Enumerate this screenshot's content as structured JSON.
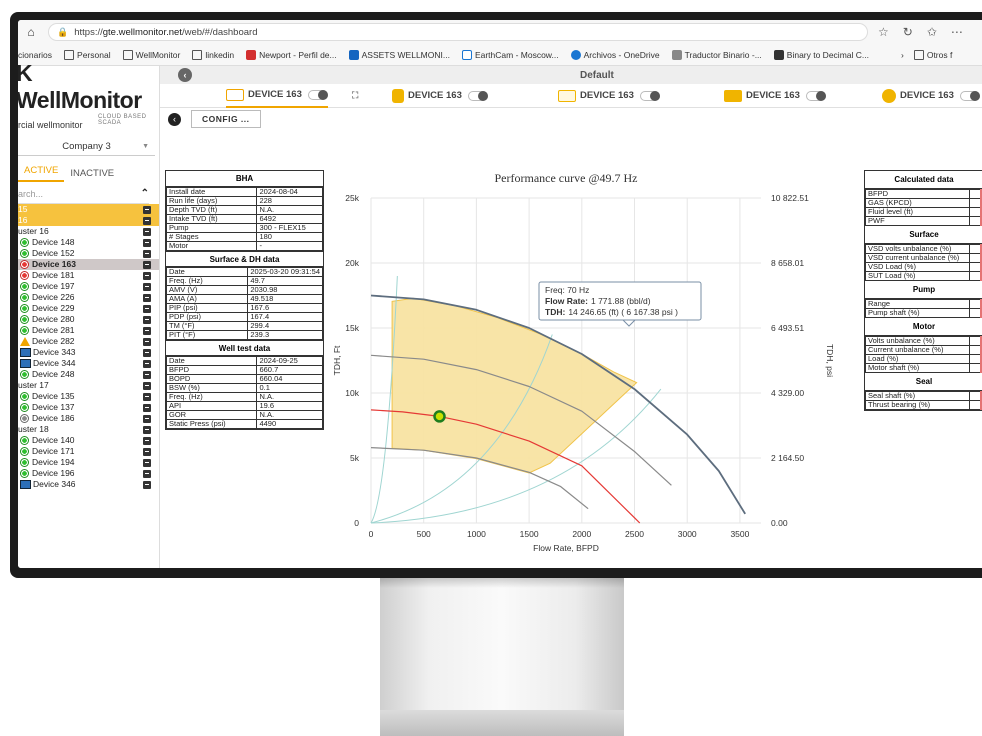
{
  "browser": {
    "url_prefix": "https://",
    "url_host": "gte.wellmonitor.net",
    "url_path": "/web/#/dashboard",
    "bookmarks": [
      "cionarios",
      "Personal",
      "WellMonitor",
      "linkedin",
      "Newport - Perfil de...",
      "ASSETS WELLMONI...",
      "EarthCam - Moscow...",
      "Archivos - OneDrive",
      "Traductor Binario -...",
      "Binary to Decimal C...",
      "Otros f"
    ]
  },
  "sidebar": {
    "logo_main": "WellMonitor",
    "logo_sub": "CLOUD BASED SCADA",
    "client": "rcial wellmonitor",
    "company": "Company 3",
    "tab_active": "ACTIVE",
    "tab_inactive": "INACTIVE",
    "search_placeholder": "arch...",
    "tree": [
      {
        "label": "15",
        "type": "cluster-hl"
      },
      {
        "label": "16",
        "type": "cluster-hl"
      },
      {
        "label": "uster 16",
        "type": "cluster"
      },
      {
        "label": "Device 148",
        "status": "green"
      },
      {
        "label": "Device 152",
        "status": "green"
      },
      {
        "label": "Device 163",
        "status": "red",
        "selected": true
      },
      {
        "label": "Device 181",
        "status": "red"
      },
      {
        "label": "Device 197",
        "status": "green"
      },
      {
        "label": "Device 226",
        "status": "green"
      },
      {
        "label": "Device 229",
        "status": "green"
      },
      {
        "label": "Device 280",
        "status": "green"
      },
      {
        "label": "Device 281",
        "status": "green"
      },
      {
        "label": "Device 282",
        "status": "warning"
      },
      {
        "label": "Device 343",
        "status": "box"
      },
      {
        "label": "Device 344",
        "status": "box"
      },
      {
        "label": "Device 248",
        "status": "green"
      },
      {
        "label": "uster 17",
        "type": "cluster"
      },
      {
        "label": "Device 135",
        "status": "green"
      },
      {
        "label": "Device 137",
        "status": "green"
      },
      {
        "label": "Device 186",
        "status": "gray"
      },
      {
        "label": "uster 18",
        "type": "cluster"
      },
      {
        "label": "Device 140",
        "status": "green"
      },
      {
        "label": "Device 171",
        "status": "green"
      },
      {
        "label": "Device 194",
        "status": "green"
      },
      {
        "label": "Device 196",
        "status": "green"
      },
      {
        "label": "Device 346",
        "status": "box"
      }
    ]
  },
  "topband": {
    "title": "Default"
  },
  "device_tabs": [
    "DEVICE 163",
    "DEVICE 163",
    "DEVICE 163",
    "DEVICE 163",
    "DEVICE 163"
  ],
  "config_label": "CONFIG ...",
  "bha": {
    "title": "BHA",
    "rows": [
      [
        "Install date",
        "2024-08-04"
      ],
      [
        "Run life (days)",
        "228"
      ],
      [
        "Depth TVD (ft)",
        "N.A."
      ],
      [
        "Intake TVD (ft)",
        "6492"
      ],
      [
        "Pump",
        "300 - FLEX15"
      ],
      [
        "# Stages",
        "180"
      ],
      [
        "Motor",
        "-"
      ]
    ]
  },
  "surface_dh": {
    "title": "Surface & DH data",
    "rows": [
      [
        "Date",
        "2025-03-20 09:31:54"
      ],
      [
        "Freq. (Hz)",
        "49.7"
      ],
      [
        "AMV (V)",
        "2030.98"
      ],
      [
        "AMA (A)",
        "49.518"
      ],
      [
        "PIP (psi)",
        "167.6"
      ],
      [
        "PDP (psi)",
        "167.4"
      ],
      [
        "TM (°F)",
        "299.4"
      ],
      [
        "PIT (°F)",
        "239.3"
      ]
    ]
  },
  "well_test": {
    "title": "Well test data",
    "rows": [
      [
        "Date",
        "2024-09-25"
      ],
      [
        "BFPD",
        "660.7"
      ],
      [
        "BOPD",
        "660.04"
      ],
      [
        "BSW (%)",
        "0.1"
      ],
      [
        "Freq. (Hz)",
        "N.A."
      ],
      [
        "API",
        "19.6"
      ],
      [
        "GOR",
        "N.A."
      ],
      [
        "Static Press (psi)",
        "4490"
      ]
    ]
  },
  "calculated": {
    "title": "Calculated data",
    "rows": [
      "BFPD",
      "GAS (KPCD)",
      "Fluid level (ft)",
      "PWF"
    ]
  },
  "surface": {
    "title": "Surface",
    "rows": [
      "VSD volts unbalance (%)",
      "VSD current unbalance (%)",
      "VSD Load (%)",
      "SUT Load (%)"
    ]
  },
  "pump": {
    "title": "Pump",
    "rows": [
      "Range",
      "Pump shaft (%)"
    ]
  },
  "motor": {
    "title": "Motor",
    "rows": [
      "Volts unbalance (%)",
      "Current unbalance (%)",
      "Load (%)",
      "Motor shaft (%)"
    ]
  },
  "seal": {
    "title": "Seal",
    "rows": [
      "Seal shaft (%)",
      "Thrust bearing (%)"
    ]
  },
  "chart_data": {
    "type": "line",
    "title": "Performance curve @49.7 Hz",
    "xlabel": "Flow Rate, BFPD",
    "ylabel": "TDH, Ft",
    "y2label": "TDH, psi",
    "xlim": [
      0,
      3700
    ],
    "ylim": [
      0,
      25000
    ],
    "x_ticks": [
      0,
      500,
      1000,
      1500,
      2000,
      2500,
      3000,
      3500
    ],
    "y_ticks": [
      0,
      5000,
      10000,
      15000,
      20000,
      25000
    ],
    "y_tick_labels": [
      "0",
      "5k",
      "10k",
      "15k",
      "20k",
      "25k"
    ],
    "y2_tick_labels": [
      "0.00",
      "2 164.50",
      "4 329.00",
      "6 493.51",
      "8 658.01",
      "10 822.51"
    ],
    "grid": true,
    "series": [
      {
        "color": "#5d6d7e",
        "x": [
          0,
          500,
          1000,
          1500,
          2000,
          2500,
          3000,
          3300,
          3550
        ],
        "y": [
          17500,
          17200,
          16400,
          15000,
          13000,
          10300,
          6800,
          4000,
          700
        ]
      },
      {
        "color": "#8a8a8a",
        "x": [
          0,
          500,
          1000,
          1500,
          2000,
          2500,
          2850
        ],
        "y": [
          12900,
          12600,
          11800,
          10500,
          8600,
          5500,
          2900
        ]
      },
      {
        "color": "#e53935",
        "x": [
          0,
          300,
          650,
          1000,
          1500,
          2000,
          2550
        ],
        "y": [
          8700,
          8550,
          8200,
          7600,
          6300,
          4400,
          0
        ]
      },
      {
        "color": "#8a8a8a",
        "x": [
          0,
          500,
          1000,
          1500,
          1800,
          2060
        ],
        "y": [
          5800,
          5600,
          5000,
          3900,
          2800,
          1100
        ]
      }
    ],
    "envelope": {
      "fill": "#f8e3a3",
      "color": "#f0c040"
    },
    "operating_point": {
      "x": 650,
      "y": 8200
    },
    "tooltip": {
      "freq": "Freq: 70 Hz",
      "flow_label": "Flow Rate:",
      "flow_value": "1 771.88 (bbl/d)",
      "tdh_label": "TDH:",
      "tdh_value": "14 246.65 (ft) ( 6 167.38 psi )"
    }
  }
}
